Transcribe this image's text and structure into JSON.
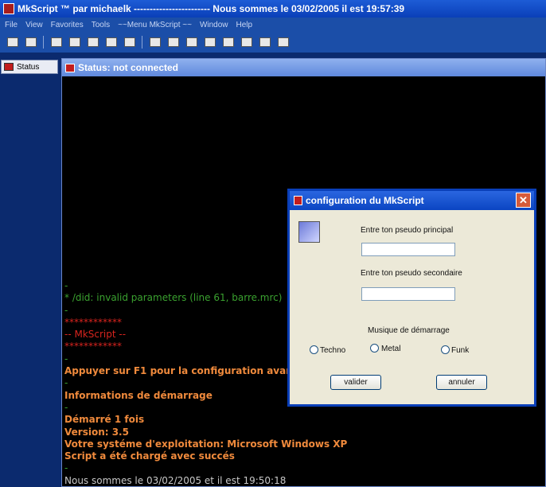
{
  "title_bar": {
    "title": "MkScript ™ par michaelk ------------------------ Nous sommes le 03/02/2005 il est 19:57:39",
    "app_icon": "mkscript-app-icon"
  },
  "menubar": {
    "items": [
      "File",
      "View",
      "Favorites",
      "Tools",
      "~~Menu MkScript ~~",
      "Window",
      "Help"
    ]
  },
  "toolbar": {
    "buttons": [
      "connect-icon",
      "options-icon",
      "address-book-icon",
      "channels-icon",
      "list-icon",
      "dcc-icon",
      "windows-logo-icon",
      "folder-icon",
      "script-icon",
      "log-icon",
      "timer-icon",
      "colors-icon",
      "about-icon",
      "notify-icon",
      "help-icon"
    ]
  },
  "treebar": {
    "item": "Status"
  },
  "status_window": {
    "title": "Status: not connected",
    "lines": [
      {
        "text": "-",
        "style": "c-green"
      },
      {
        "text": "* /did: invalid parameters (line 61, barre.mrc)",
        "style": "c-green"
      },
      {
        "text": "-",
        "style": "c-green"
      },
      {
        "text": "************",
        "style": "c-red"
      },
      {
        "text": "-- MkScript --",
        "style": "c-red"
      },
      {
        "text": "************",
        "style": "c-red"
      },
      {
        "text": "-",
        "style": "c-green"
      },
      {
        "text": "Appuyer sur F1 pour la configuration avanc",
        "style": "c-orange"
      },
      {
        "text": "-",
        "style": "c-green"
      },
      {
        "text": "Informations de démarrage",
        "style": "c-orange"
      },
      {
        "text": "-",
        "style": "c-green"
      },
      {
        "text": "Démarré 1 fois",
        "style": "c-orange"
      },
      {
        "text": "Version: 3.5",
        "style": "c-orange"
      },
      {
        "text": "Votre systéme d'exploitation: Microsoft Windows XP",
        "style": "c-orange"
      },
      {
        "text": "Script a été chargé avec succés",
        "style": "c-orange"
      },
      {
        "text": "-",
        "style": "c-green"
      },
      {
        "text": "Nous sommes le 03/02/2005  et il est 19:50:18",
        "style": "c-white"
      }
    ]
  },
  "dialog": {
    "title": "configuration du MkScript",
    "label_principal": "Entre ton pseudo principal",
    "label_secondaire": "Entre ton pseudo secondaire",
    "value_principal": "",
    "value_secondaire": "",
    "music_label": "Musique de démarrage",
    "options": [
      "Techno",
      "Metal",
      "Funk"
    ],
    "ok_label": "valider",
    "cancel_label": "annuler"
  }
}
